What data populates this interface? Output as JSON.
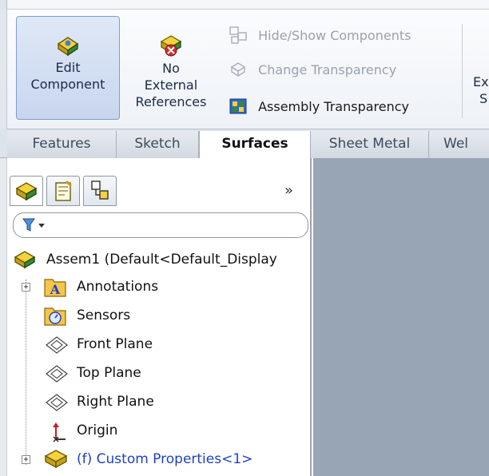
{
  "ribbon": {
    "edit_component": [
      "Edit",
      "Component"
    ],
    "no_external_references": [
      "No",
      "External",
      "References"
    ],
    "hide_show_components": "Hide/Show Components",
    "change_transparency": "Change Transparency",
    "assembly_transparency": "Assembly Transparency",
    "cut_label": [
      "Ex",
      "S"
    ]
  },
  "tabs": [
    "Features",
    "Sketch",
    "Surfaces",
    "Sheet Metal",
    "Wel"
  ],
  "active_tab": "Surfaces",
  "panel": {
    "chevron": "»"
  },
  "tree": {
    "root": "Assem1  (Default<Default_Display",
    "items": [
      {
        "label": "Annotations",
        "icon": "annotations-icon",
        "expandable": true
      },
      {
        "label": "Sensors",
        "icon": "sensors-icon",
        "expandable": false
      },
      {
        "label": "Front Plane",
        "icon": "plane-icon",
        "expandable": false
      },
      {
        "label": "Top Plane",
        "icon": "plane-icon",
        "expandable": false
      },
      {
        "label": "Right Plane",
        "icon": "plane-icon",
        "expandable": false
      },
      {
        "label": "Origin",
        "icon": "origin-icon",
        "expandable": false
      },
      {
        "label": "(f) Custom Properties<1>",
        "icon": "component-icon",
        "expandable": true,
        "color": "#1f3fc4"
      }
    ]
  },
  "colors": {
    "graphics_bg": "#98a5b4",
    "active_button_bg": "#c8d6ee",
    "link_blue": "#1f3fc4"
  }
}
